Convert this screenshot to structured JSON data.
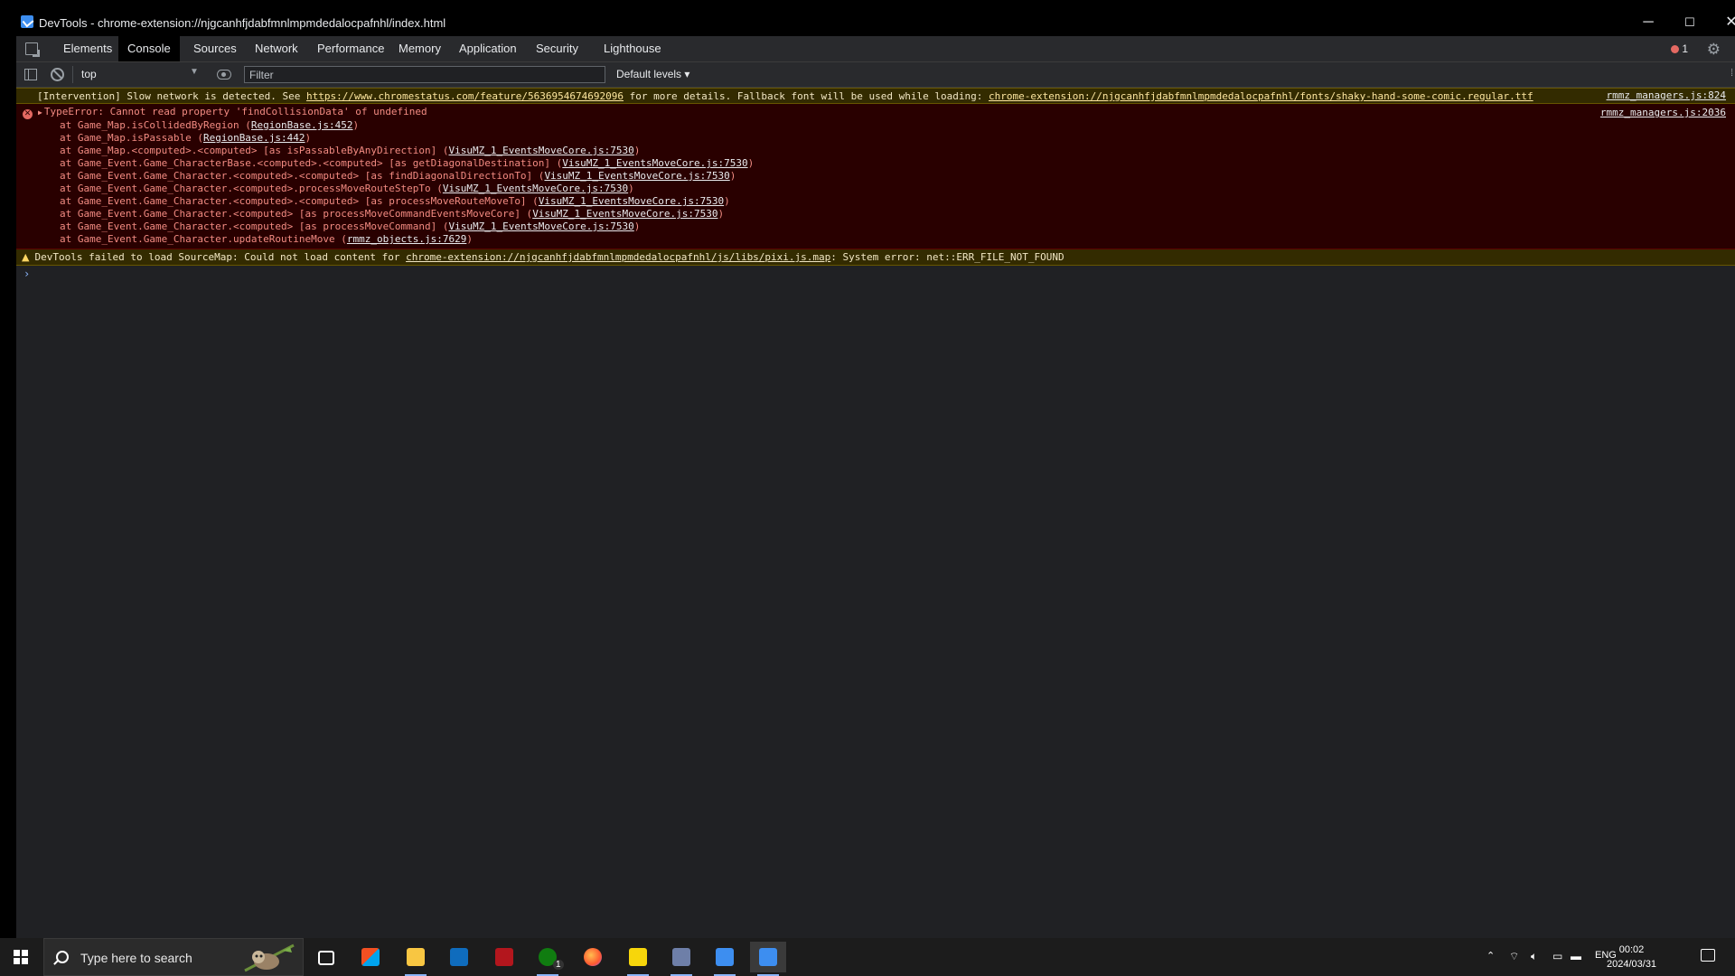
{
  "window": {
    "title": "DevTools - chrome-extension://njgcanhfjdabfmnlmpmdedalocpafnhl/index.html",
    "minimize": "─",
    "maximize": "☐",
    "close": "✕"
  },
  "tabs": [
    "Elements",
    "Console",
    "Sources",
    "Network",
    "Performance",
    "Memory",
    "Application",
    "Security",
    "Lighthouse"
  ],
  "active_tab": "Console",
  "error_count": "1",
  "toolbar": {
    "context": "top",
    "filter_placeholder": "Filter",
    "levels": "Default levels ▾"
  },
  "messages": {
    "intervention": {
      "prefix": "[Intervention] Slow network is detected. See ",
      "link1": "https://www.chromestatus.com/feature/5636954674692096",
      "middle": " for more details. Fallback font will be used while loading: ",
      "link2": "chrome-extension://njgcanhfjdabfmnlmpmdedalocpafnhl/fonts/shaky-hand-some-comic.regular.ttf",
      "source": "rmmz_managers.js:824"
    },
    "error": {
      "title": "TypeError: Cannot read property 'findCollisionData' of undefined",
      "source": "rmmz_managers.js:2036",
      "stack": [
        {
          "text": "at Game_Map.isCollidedByRegion (",
          "link": "RegionBase.js:452",
          "end": ")"
        },
        {
          "text": "at Game_Map.isPassable (",
          "link": "RegionBase.js:442",
          "end": ")"
        },
        {
          "text": "at Game_Map.<computed>.<computed> [as isPassableByAnyDirection] (",
          "link": "VisuMZ_1_EventsMoveCore.js:7530",
          "end": ")"
        },
        {
          "text": "at Game_Event.Game_CharacterBase.<computed>.<computed> [as getDiagonalDestination] (",
          "link": "VisuMZ_1_EventsMoveCore.js:7530",
          "end": ")"
        },
        {
          "text": "at Game_Event.Game_Character.<computed>.<computed> [as findDiagonalDirectionTo] (",
          "link": "VisuMZ_1_EventsMoveCore.js:7530",
          "end": ")"
        },
        {
          "text": "at Game_Event.Game_Character.<computed>.processMoveRouteStepTo (",
          "link": "VisuMZ_1_EventsMoveCore.js:7530",
          "end": ")"
        },
        {
          "text": "at Game_Event.Game_Character.<computed>.<computed> [as processMoveRouteMoveTo] (",
          "link": "VisuMZ_1_EventsMoveCore.js:7530",
          "end": ")"
        },
        {
          "text": "at Game_Event.Game_Character.<computed> [as processMoveCommandEventsMoveCore] (",
          "link": "VisuMZ_1_EventsMoveCore.js:7530",
          "end": ")"
        },
        {
          "text": "at Game_Event.Game_Character.<computed> [as processMoveCommand] (",
          "link": "VisuMZ_1_EventsMoveCore.js:7530",
          "end": ")"
        },
        {
          "text": "at Game_Event.Game_Character.updateRoutineMove (",
          "link": "rmmz_objects.js:7629",
          "end": ")"
        }
      ]
    },
    "warning": {
      "prefix": "DevTools failed to load SourceMap: Could not load content for ",
      "link": "chrome-extension://njgcanhfjdabfmnlmpmdedalocpafnhl/js/libs/pixi.js.map",
      "suffix": ": System error: net::ERR_FILE_NOT_FOUND"
    },
    "prompt": "›"
  },
  "taskbar": {
    "search_placeholder": "Type here to search",
    "apps": [
      "task-view",
      "microsoft-store",
      "file-explorer",
      "mail",
      "app-red",
      "xbox",
      "firefox",
      "sticky-notes",
      "rpg-maker",
      "devtools-1",
      "devtools-2"
    ],
    "xbox_badge": "1",
    "tray_language": "ENG",
    "time": "00:02",
    "date": "2024/03/31"
  },
  "colors": {
    "error_text": "#f28b82",
    "error_bg": "#290000",
    "warning_bg": "#332b00",
    "accent": "#8ab4f8"
  }
}
